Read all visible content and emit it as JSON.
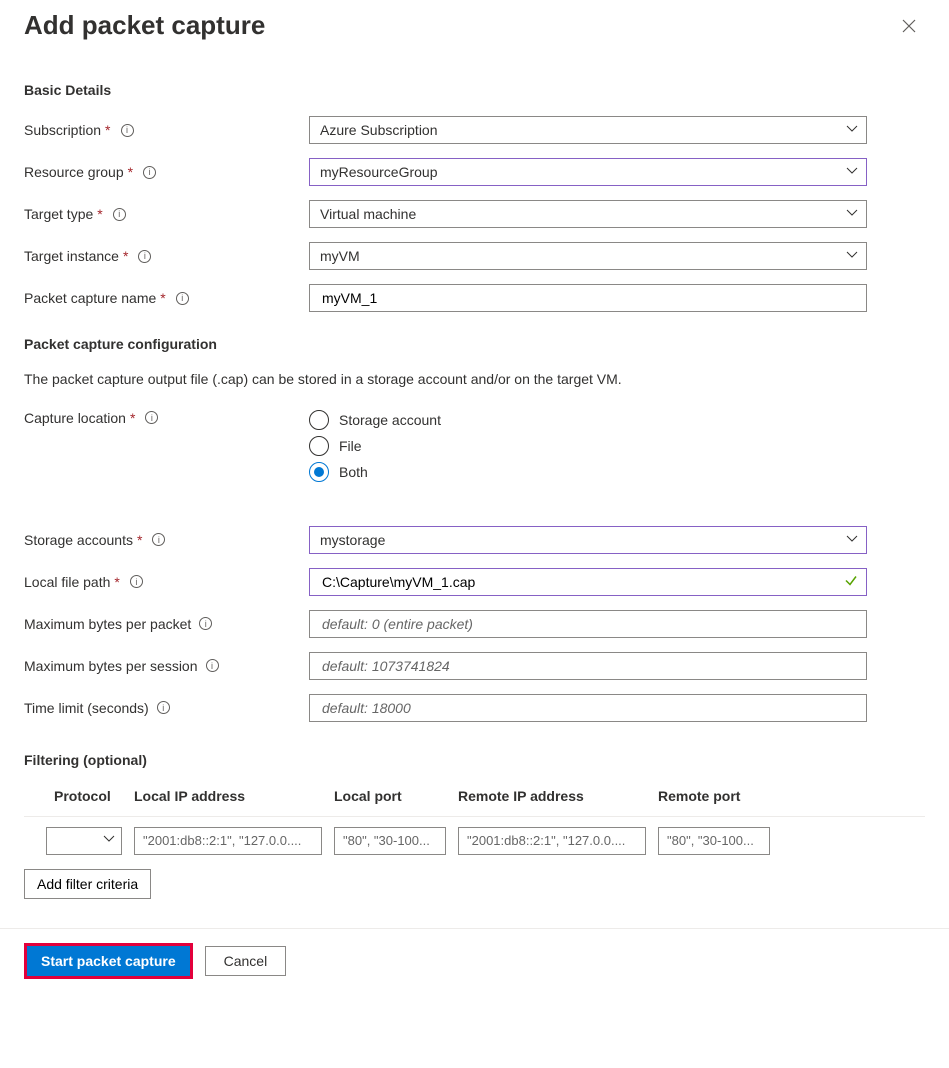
{
  "header": {
    "title": "Add packet capture"
  },
  "sections": {
    "basic": "Basic Details",
    "config": "Packet capture configuration",
    "filtering": "Filtering (optional)"
  },
  "labels": {
    "subscription": "Subscription",
    "resourceGroup": "Resource group",
    "targetType": "Target type",
    "targetInstance": "Target instance",
    "captureName": "Packet capture name",
    "captureLocation": "Capture location",
    "storageAccounts": "Storage accounts",
    "localFilePath": "Local file path",
    "maxBytesPacket": "Maximum bytes per packet",
    "maxBytesSession": "Maximum bytes per session",
    "timeLimit": "Time limit (seconds)"
  },
  "values": {
    "subscription": "Azure Subscription",
    "resourceGroup": "myResourceGroup",
    "targetType": "Virtual machine",
    "targetInstance": "myVM",
    "captureName": "myVM_1",
    "storageAccounts": "mystorage",
    "localFilePath": "C:\\Capture\\myVM_1.cap"
  },
  "placeholders": {
    "maxBytesPacket": "default: 0 (entire packet)",
    "maxBytesSession": "default: 1073741824",
    "timeLimit": "default: 18000"
  },
  "configNote": "The packet capture output file (.cap) can be stored in a storage account and/or on the target VM.",
  "captureLocationOptions": {
    "storage": "Storage account",
    "file": "File",
    "both": "Both"
  },
  "filter": {
    "headers": {
      "protocol": "Protocol",
      "localIp": "Local IP address",
      "localPort": "Local port",
      "remoteIp": "Remote IP address",
      "remotePort": "Remote port"
    },
    "placeholders": {
      "localIp": "\"2001:db8::2:1\", \"127.0.0....",
      "localPort": "\"80\", \"30-100...",
      "remoteIp": "\"2001:db8::2:1\", \"127.0.0....",
      "remotePort": "\"80\", \"30-100..."
    },
    "addButton": "Add filter criteria"
  },
  "footer": {
    "start": "Start packet capture",
    "cancel": "Cancel"
  }
}
